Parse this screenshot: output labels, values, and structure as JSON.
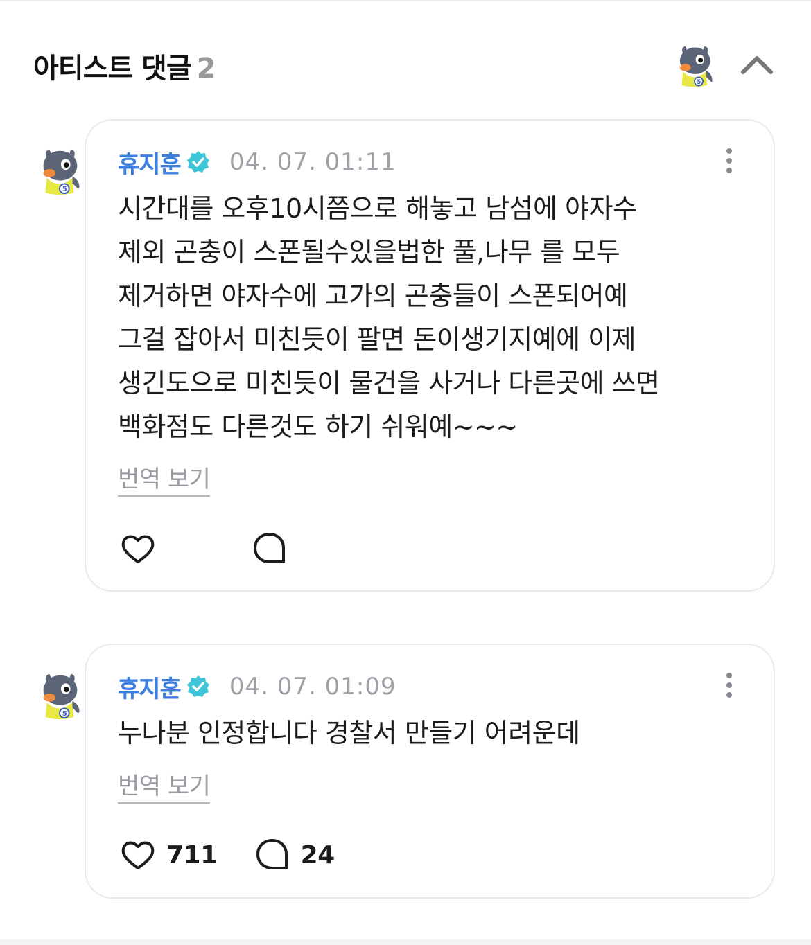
{
  "header": {
    "title": "아티스트 댓글",
    "count": "2"
  },
  "icons": {
    "avatar": "penguin-avatar-icon",
    "verified": "verified-badge-icon",
    "collapse": "chevron-up-icon",
    "more": "more-vertical-icon",
    "like": "heart-icon",
    "reply": "comment-bubble-icon"
  },
  "colors": {
    "author": "#3d7fe0",
    "verified_badge": "#3ec5d8",
    "muted": "#a0a0a8",
    "card_border": "#e9e9ef"
  },
  "comments": [
    {
      "author": "휴지훈",
      "date": "04. 07. 01:11",
      "text": "시간대를 오후10시쯤으로 해놓고 남섬에 야자수\n제외 곤충이 스폰될수있을법한 풀,나무 를 모두\n제거하면 야자수에 고가의 곤충들이 스폰되어예\n그걸 잡아서 미친듯이 팔면 돈이생기지예에 이제\n생긴도으로 미친듯이 물건을 사거나 다른곳에 쓰면\n백화점도 다른것도 하기 쉬워예~~~",
      "translate_label": "번역 보기",
      "likes": "",
      "replies": ""
    },
    {
      "author": "휴지훈",
      "date": "04. 07. 01:09",
      "text": "누나분 인정합니다 경찰서 만들기 어려운데",
      "translate_label": "번역 보기",
      "likes": "711",
      "replies": "24"
    }
  ]
}
